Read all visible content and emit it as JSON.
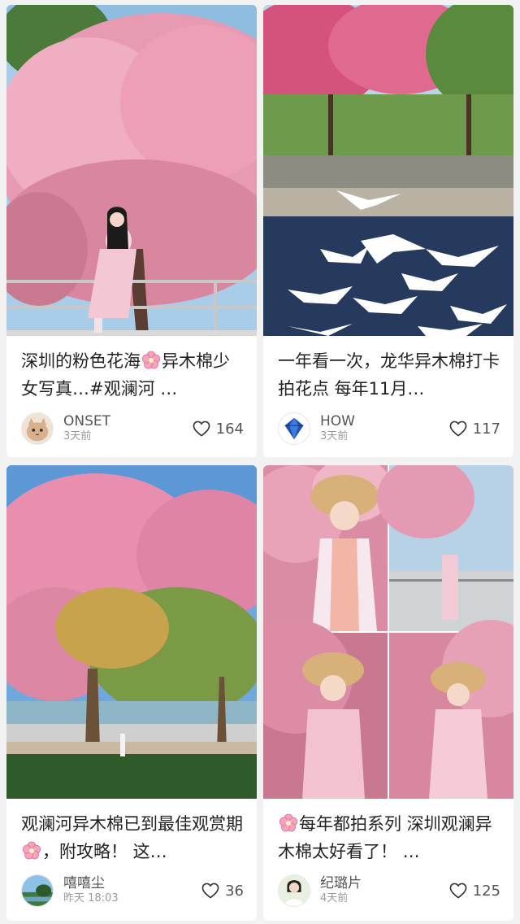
{
  "posts": [
    {
      "title_parts": [
        "深圳的粉色花海",
        "异木棉少女写真…#观澜河 …"
      ],
      "author": "ONSET",
      "time": "3天前",
      "likes": "164",
      "image": "pink-kapok-tree-girl-on-railing",
      "avatar": "cat-avatar"
    },
    {
      "title": "一年看一次，龙华异木棉打卡拍花点 每年11月…",
      "author": "HOW",
      "time": "3天前",
      "likes": "117",
      "image": "kapok-trees-river-egrets",
      "avatar": "blue-gem-avatar"
    },
    {
      "title_parts": [
        "观澜河异木棉已到最佳观赏期",
        "，附攻略！ 这…"
      ],
      "author": "嘻嘻尘",
      "time": "昨天 18:03",
      "likes": "36",
      "image": "kapok-trees-park-path",
      "avatar": "landscape-avatar"
    },
    {
      "title_parts": [
        "",
        "每年都拍系列 深圳观澜异木棉太好看了！ …"
      ],
      "author": "纪璐片",
      "time": "4天前",
      "likes": "125",
      "image": "straw-hat-girl-photo-collage",
      "avatar": "girl-portrait-avatar"
    }
  ],
  "colors": {
    "background": "#f2f2f2",
    "card": "#ffffff",
    "title": "#222222",
    "meta": "#9a9a9a",
    "blossom": "#f08aa8"
  }
}
